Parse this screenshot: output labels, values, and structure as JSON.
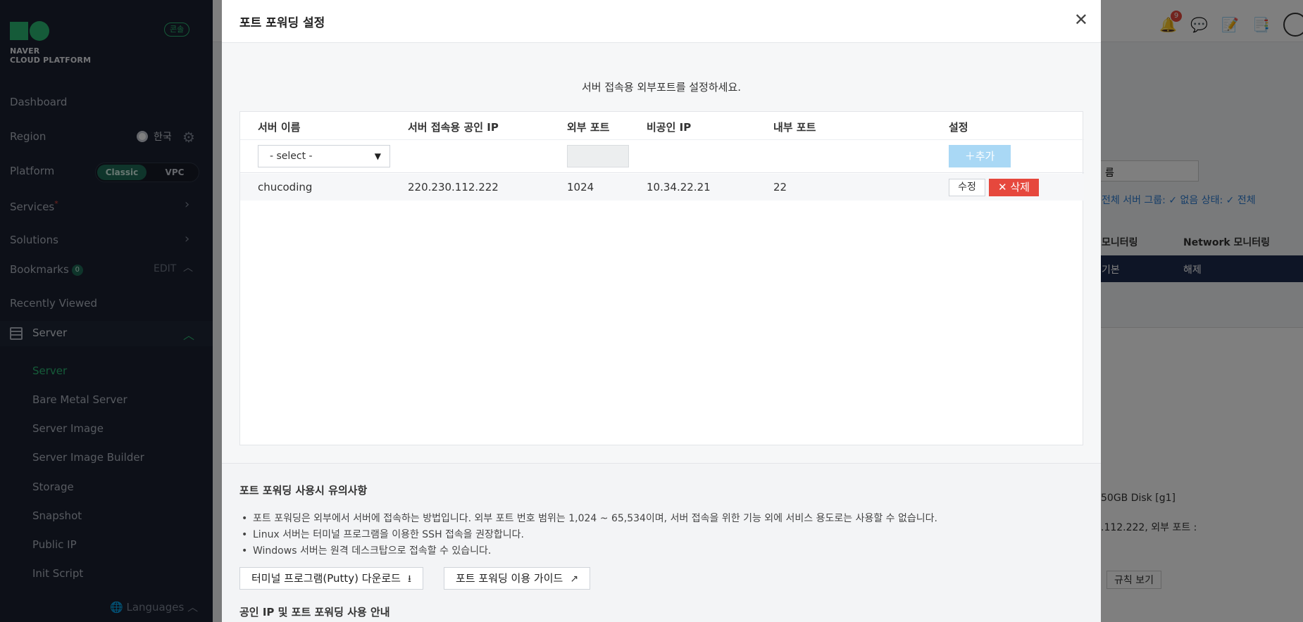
{
  "sidebar": {
    "logo_line1": "NAVER",
    "logo_line2": "CLOUD PLATFORM",
    "console_badge": "콘솔",
    "dashboard": "Dashboard",
    "region_label": "Region",
    "region_value": "한국",
    "platform_label": "Platform",
    "platform_classic": "Classic",
    "platform_vpc": "VPC",
    "services": "Services",
    "services_marker": "*",
    "solutions": "Solutions",
    "bookmarks": "Bookmarks",
    "bookmarks_count": "0",
    "bookmarks_edit": "EDIT",
    "recently_viewed": "Recently Viewed",
    "server_section": "Server",
    "sub_items": [
      "Server",
      "Bare Metal Server",
      "Server Image",
      "Server Image Builder",
      "Storage",
      "Snapshot",
      "Public IP",
      "Init Script"
    ],
    "languages": "Languages"
  },
  "topbar": {
    "notification_count": "9"
  },
  "background": {
    "select_fragment": "름",
    "filter_text": "전체  서버 그룹: ✓ 없음  상태: ✓ 전체",
    "col_monitoring": "모니터링",
    "col_network": "Network 모니터링",
    "row_basic": "기본",
    "row_release": "해제",
    "disk_text": "50GB Disk [g1]",
    "ip_text": ".112.222, 외부 포트 :",
    "rule_button": "규칙 보기"
  },
  "modal": {
    "title": "포트 포워딩 설정",
    "instruction": "서버 접속용 외부포트를 설정하세요.",
    "columns": [
      "서버 이름",
      "서버 접속용 공인 IP",
      "외부 포트",
      "비공인 IP",
      "내부 포트",
      "설정"
    ],
    "select_value": "- select -",
    "add_label": "추가",
    "rows": [
      {
        "name": "chucoding",
        "public_ip": "220.230.112.222",
        "ext_port": "1024",
        "private_ip": "10.34.22.21",
        "int_port": "22"
      }
    ],
    "edit_label": "수정",
    "delete_label": "삭제",
    "notes_title": "포트 포워딩 사용시 유의사항",
    "notes": [
      "포트 포워딩은 외부에서 서버에 접속하는 방법입니다. 외부 포트 번호 범위는 1,024 ~ 65,534이며, 서버 접속을 위한 기능 외에 서비스 용도로는 사용할 수 없습니다.",
      "Linux 서버는 터미널 프로그램을 이용한 SSH 접속을 권장합니다.",
      "Windows 서버는 원격 데스크탑으로 접속할 수 있습니다."
    ],
    "putty_button": "터미널 프로그램(Putty) 다운로드",
    "guide_button": "포트 포워딩 이용 가이드",
    "notes_title2": "공인 IP 및 포트 포워딩 사용 안내"
  },
  "colors": {
    "accent": "#2bb673",
    "danger": "#e6483d",
    "add_disabled": "#a9d8f5",
    "sidebar_bg": "#1b2130"
  }
}
